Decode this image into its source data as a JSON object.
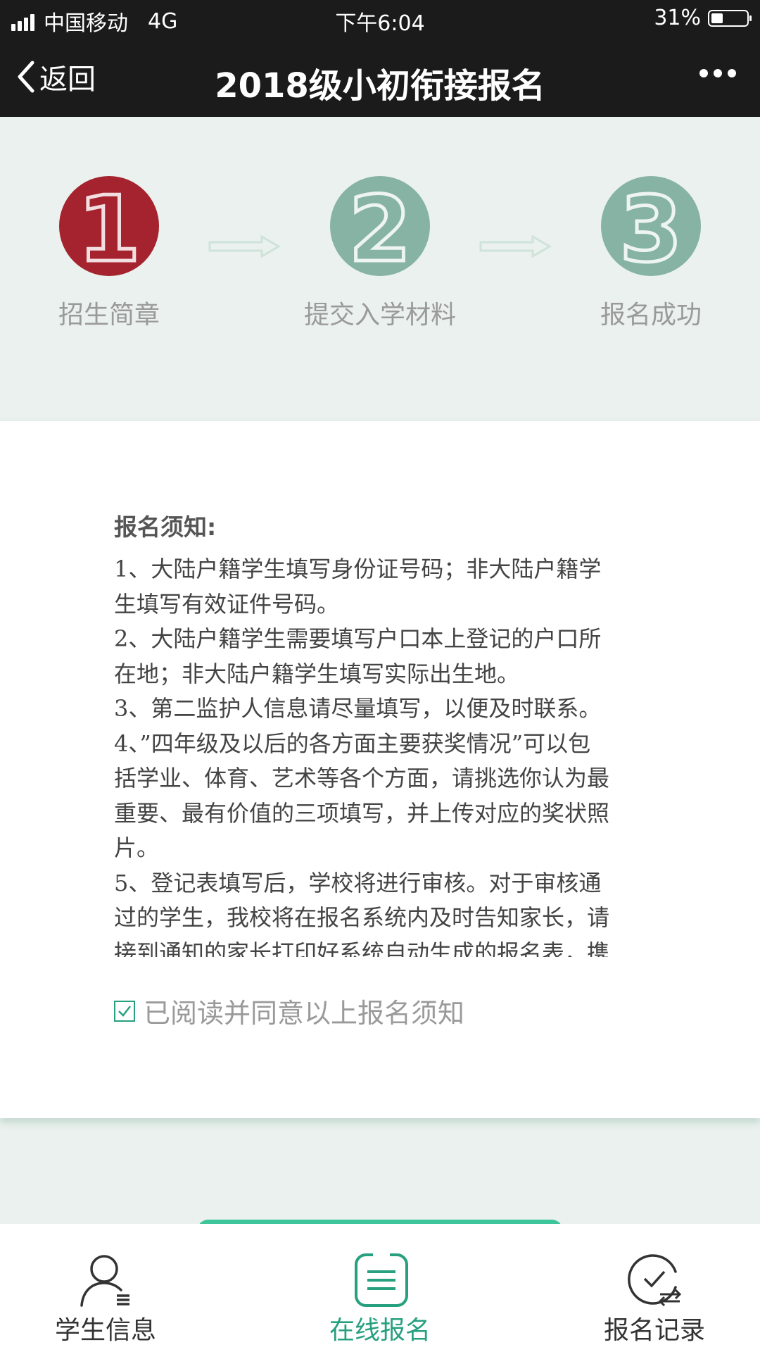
{
  "status_bar": {
    "carrier": "中国移动",
    "network": "4G",
    "time": "下午6:04",
    "battery": "31%",
    "battery_level": 0.31
  },
  "nav": {
    "back_label": "返回",
    "title": "2018级小初衔接报名",
    "more_icon": "more-dots-icon"
  },
  "steps": [
    {
      "number": "1",
      "label": "招生简章",
      "color": "#a5232e"
    },
    {
      "number": "2",
      "label": "提交入学材料",
      "color": "#86b3a4"
    },
    {
      "number": "3",
      "label": "报名成功",
      "color": "#86b3a4"
    }
  ],
  "notice": {
    "title": "报名须知:",
    "lines": [
      "1、大陆户籍学生填写身份证号码；非大陆户籍学",
      "生填写有效证件号码。",
      "2、大陆户籍学生需要填写户口本上登记的户口所",
      "在地；非大陆户籍学生填写实际出生地。",
      "3、第二监护人信息请尽量填写，以便及时联系。",
      "4、”四年级及以后的各方面主要获奖情况”可以包",
      "括学业、体育、艺术等各个方面，请挑选你认为最",
      "重要、最有价值的三项填写，并上传对应的奖状照",
      "片。",
      "5、登记表填写后，学校将进行审核。对于审核通",
      "过的学生，我校将在报名系统内及时告知家长，请",
      "接到通知的家长打印好系统自动生成的报名表，携"
    ],
    "agree_label": "已阅读并同意以上报名须知",
    "agree_checked": true
  },
  "tabs": [
    {
      "label": "学生信息",
      "icon": "person-list-icon",
      "active": false
    },
    {
      "label": "在线报名",
      "icon": "clipboard-icon",
      "active": true
    },
    {
      "label": "报名记录",
      "icon": "clock-check-icon",
      "active": false
    }
  ],
  "colors": {
    "accent": "#26a07f",
    "step_active": "#a5232e",
    "step_inactive": "#86b3a4"
  }
}
